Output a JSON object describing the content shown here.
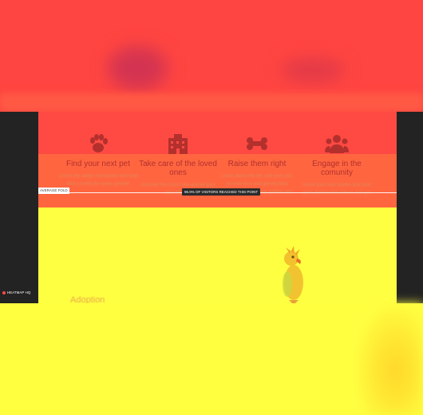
{
  "features": [
    {
      "title": "Find your next pet",
      "description": "Check the adopt connection and help find a home for every animal!",
      "icon": "paw-icon"
    },
    {
      "title": "Take care of the loved ones",
      "description": "Discover the most care and all your best friends",
      "icon": "building-icon"
    },
    {
      "title": "Raise them right",
      "description": "Learn about the life side your pet, provide love and get the best products to lead them gather and",
      "icon": "bone-icon"
    },
    {
      "title": "Engage in the comunity",
      "description": "Share your own stories and your pet's photos with others and get",
      "icon": "users-icon"
    }
  ],
  "overlay": {
    "reach_label": "96.9% OF VISITORS REACHED THIS POINT",
    "fold_label": "AVERAGE FOLD",
    "heatmap_label": "HEATMAP HQ"
  },
  "section": {
    "adoption_heading": "Adoption"
  },
  "colors": {
    "hero": "#ff4541",
    "features_band": "#ff6640",
    "yellow": "#ffff42",
    "dark": "#232323"
  }
}
